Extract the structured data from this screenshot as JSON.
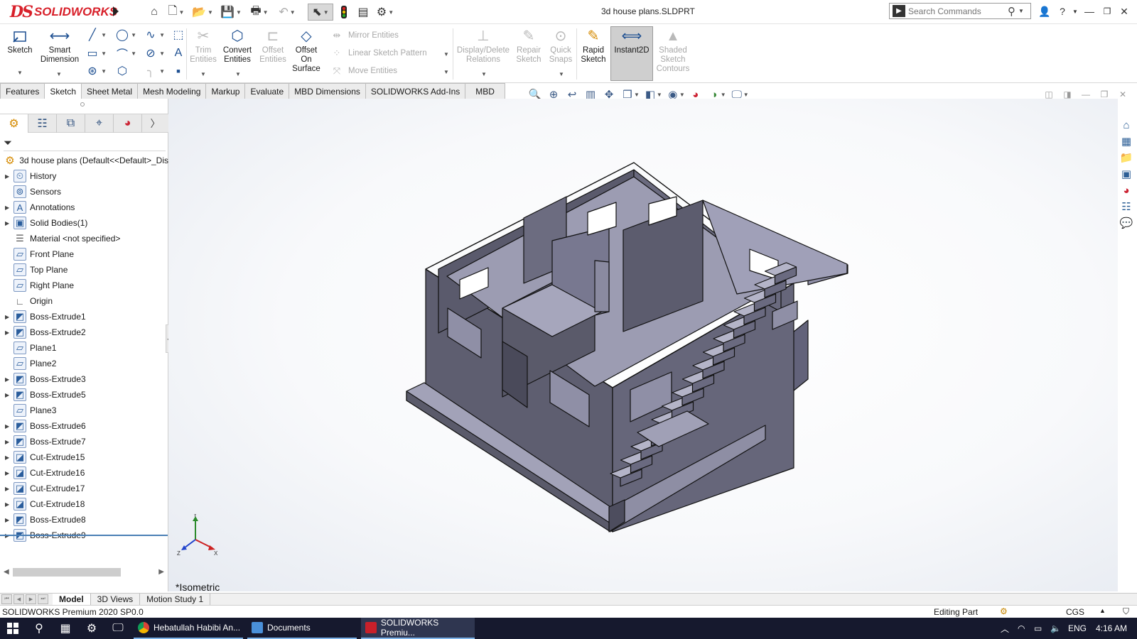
{
  "app": {
    "brand_glyph": "DS",
    "brand_name": "SOLIDWORKS",
    "document_title": "3d house plans.SLDPRT"
  },
  "search": {
    "placeholder": "Search Commands"
  },
  "command_manager": {
    "sketch": "Sketch",
    "smart_dimension": "Smart Dimension",
    "trim_entities": "Trim Entities",
    "convert_entities": "Convert Entities",
    "offset_entities": "Offset Entities",
    "offset_on_surface": "Offset On Surface",
    "mirror_entities": "Mirror Entities",
    "linear_sketch_pattern": "Linear Sketch Pattern",
    "move_entities": "Move Entities",
    "display_delete_relations": "Display/Delete Relations",
    "repair_sketch": "Repair Sketch",
    "quick_snaps": "Quick Snaps",
    "rapid_sketch": "Rapid Sketch",
    "instant2d": "Instant2D",
    "shaded_sketch_contours": "Shaded Sketch Contours"
  },
  "tabs": [
    "Features",
    "Sketch",
    "Sheet Metal",
    "Mesh Modeling",
    "Markup",
    "Evaluate",
    "MBD Dimensions",
    "SOLIDWORKS Add-Ins",
    "MBD"
  ],
  "active_tab": "Sketch",
  "feature_tree": {
    "root": "3d house plans  (Default<<Default>_Dis",
    "items": [
      {
        "label": "History",
        "expandable": true,
        "icon": "history-icon"
      },
      {
        "label": "Sensors",
        "expandable": false,
        "icon": "sensor-icon"
      },
      {
        "label": "Annotations",
        "expandable": true,
        "icon": "annotation-icon"
      },
      {
        "label": "Solid Bodies(1)",
        "expandable": true,
        "icon": "solid-bodies-icon"
      },
      {
        "label": "Material <not specified>",
        "expandable": false,
        "icon": "material-icon"
      },
      {
        "label": "Front Plane",
        "expandable": false,
        "icon": "plane-icon"
      },
      {
        "label": "Top Plane",
        "expandable": false,
        "icon": "plane-icon"
      },
      {
        "label": "Right Plane",
        "expandable": false,
        "icon": "plane-icon"
      },
      {
        "label": "Origin",
        "expandable": false,
        "icon": "origin-icon"
      },
      {
        "label": "Boss-Extrude1",
        "expandable": true,
        "icon": "boss-extrude-icon"
      },
      {
        "label": "Boss-Extrude2",
        "expandable": true,
        "icon": "boss-extrude-icon"
      },
      {
        "label": "Plane1",
        "expandable": false,
        "icon": "plane-icon"
      },
      {
        "label": "Plane2",
        "expandable": false,
        "icon": "plane-icon"
      },
      {
        "label": "Boss-Extrude3",
        "expandable": true,
        "icon": "boss-extrude-icon"
      },
      {
        "label": "Boss-Extrude5",
        "expandable": true,
        "icon": "boss-extrude-icon"
      },
      {
        "label": "Plane3",
        "expandable": false,
        "icon": "plane-icon"
      },
      {
        "label": "Boss-Extrude6",
        "expandable": true,
        "icon": "boss-extrude-icon"
      },
      {
        "label": "Boss-Extrude7",
        "expandable": true,
        "icon": "boss-extrude-icon"
      },
      {
        "label": "Cut-Extrude15",
        "expandable": true,
        "icon": "cut-extrude-icon"
      },
      {
        "label": "Cut-Extrude16",
        "expandable": true,
        "icon": "cut-extrude-icon"
      },
      {
        "label": "Cut-Extrude17",
        "expandable": true,
        "icon": "cut-extrude-icon"
      },
      {
        "label": "Cut-Extrude18",
        "expandable": true,
        "icon": "cut-extrude-icon"
      },
      {
        "label": "Boss-Extrude8",
        "expandable": true,
        "icon": "boss-extrude-icon"
      },
      {
        "label": "Boss-Extrude9",
        "expandable": true,
        "icon": "boss-extrude-icon"
      }
    ]
  },
  "viewport": {
    "view_name": "*Isometric",
    "triad": {
      "x": "X",
      "y": "Y",
      "z": "Z"
    }
  },
  "model_tabs": [
    "Model",
    "3D Views",
    "Motion Study 1"
  ],
  "active_model_tab": "Model",
  "status": {
    "product": "SOLIDWORKS Premium 2020 SP0.0",
    "mode": "Editing Part",
    "units": "CGS"
  },
  "taskbar": {
    "apps": [
      {
        "label": "Hebatullah Habibi An...",
        "icon": "chrome-icon"
      },
      {
        "label": "Documents",
        "icon": "documents-icon"
      },
      {
        "label": "SOLIDWORKS Premiu...",
        "icon": "solidworks-icon"
      }
    ],
    "language": "ENG",
    "time": "4:16 AM"
  },
  "colors": {
    "brand_red": "#d8202a",
    "model_face_light": "#a6a6bc",
    "model_face_dark": "#5e5e6e",
    "taskbar": "#16192e"
  }
}
